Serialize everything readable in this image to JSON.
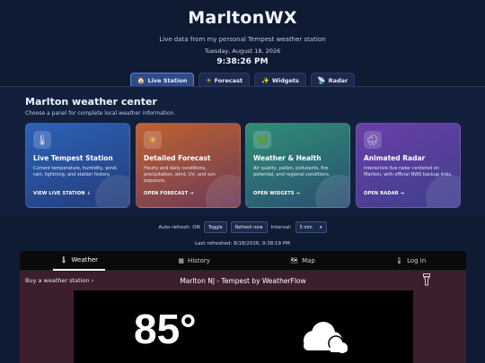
{
  "header": {
    "title": "MarltonWX",
    "subtitle": "Live data from my personal Tempest weather station",
    "date": "Tuesday, August 18, 2026",
    "time": "9:38:26 PM"
  },
  "nav": [
    {
      "label": "Live Station",
      "icon": "house-icon",
      "glyph": "🏠",
      "active": true
    },
    {
      "label": "Forecast",
      "icon": "sun-icon",
      "glyph": "☀",
      "active": false
    },
    {
      "label": "Widgets",
      "icon": "sparkle-icon",
      "glyph": "✨",
      "active": false
    },
    {
      "label": "Radar",
      "icon": "satellite-icon",
      "glyph": "📡",
      "active": false
    }
  ],
  "center": {
    "title": "Marlton weather center",
    "subtitle": "Choose a panel for complete local weather information."
  },
  "cards": [
    {
      "title": "Live Tempest Station",
      "desc": "Current temperature, humidity, wind, rain, lightning, and station history.",
      "link": "VIEW LIVE STATION ↓",
      "icon": "thermometer-icon",
      "glyph": "🌡"
    },
    {
      "title": "Detailed Forecast",
      "desc": "Hourly and daily conditions, precipitation, wind, UV, and sun exposure.",
      "link": "OPEN FORECAST →",
      "icon": "sun-icon",
      "glyph": "☀"
    },
    {
      "title": "Weather & Health",
      "desc": "Air quality, pollen, pollutants, fire potential, and regional conditions.",
      "link": "OPEN WIDGETS →",
      "icon": "leaf-icon",
      "glyph": "🌿"
    },
    {
      "title": "Animated Radar",
      "desc": "Interactive live radar centered on Marlton, with official NWS backup links.",
      "link": "OPEN RADAR →",
      "icon": "rain-cloud-icon",
      "glyph": "🌧"
    }
  ],
  "refresh": {
    "auto_label": "Auto-refresh: ON",
    "toggle_label": "Toggle",
    "refresh_now_label": "Refresh now",
    "interval_label": "Interval:",
    "interval_value": "5 min",
    "last_refreshed": "Last refreshed: 8/18/2026, 9:38:19 PM"
  },
  "widget": {
    "tabs": [
      {
        "label": "Weather",
        "icon": "thermometer-icon",
        "glyph": "🌡",
        "active": true
      },
      {
        "label": "History",
        "icon": "calendar-icon",
        "glyph": "▦",
        "active": false
      },
      {
        "label": "Map",
        "icon": "map-icon",
        "glyph": "🗺",
        "active": false
      },
      {
        "label": "Log In",
        "icon": "login-icon",
        "glyph": "🌡",
        "active": false
      }
    ],
    "buy_label": "Buy a weather station ›",
    "station_title": "Marlton NJ - Tempest by WeatherFlow",
    "temperature": "85°",
    "condition_icon": "cloudy-icon"
  }
}
